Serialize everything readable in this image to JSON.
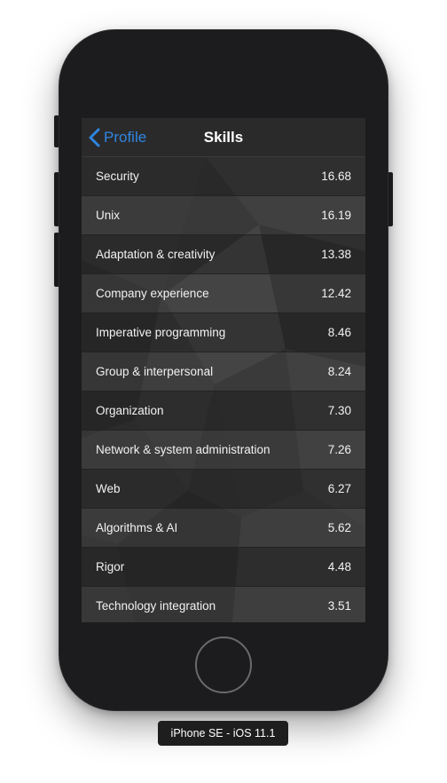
{
  "nav": {
    "back_label": "Profile",
    "title": "Skills"
  },
  "skills": [
    {
      "label": "Security",
      "value": "16.68"
    },
    {
      "label": "Unix",
      "value": "16.19"
    },
    {
      "label": "Adaptation & creativity",
      "value": "13.38"
    },
    {
      "label": "Company experience",
      "value": "12.42"
    },
    {
      "label": "Imperative programming",
      "value": "8.46"
    },
    {
      "label": "Group & interpersonal",
      "value": "8.24"
    },
    {
      "label": "Organization",
      "value": "7.30"
    },
    {
      "label": "Network & system administration",
      "value": "7.26"
    },
    {
      "label": "Web",
      "value": "6.27"
    },
    {
      "label": "Algorithms & AI",
      "value": "5.62"
    },
    {
      "label": "Rigor",
      "value": "4.48"
    },
    {
      "label": "Technology integration",
      "value": "3.51"
    }
  ],
  "device": {
    "label": "iPhone SE - iOS 11.1"
  },
  "colors": {
    "accent": "#2f86e0",
    "phone_body": "#1c1c1e",
    "screen_bg": "#2e2e2e"
  },
  "icons": {
    "back": "chevron-left-icon"
  }
}
